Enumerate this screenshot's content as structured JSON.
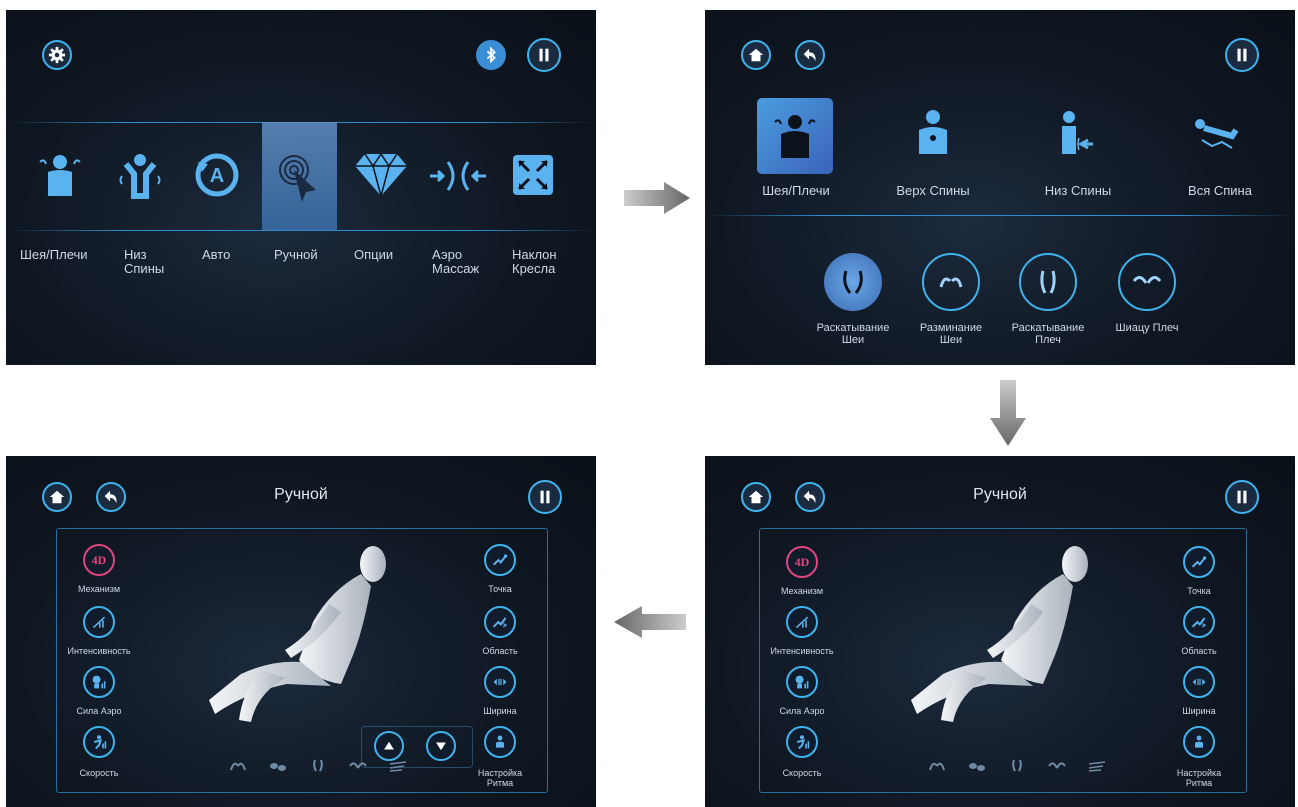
{
  "panel1": {
    "items": [
      {
        "icon": "person-shoulders-icon",
        "label": "Шея/Плечи"
      },
      {
        "icon": "lower-back-icon",
        "label": "Низ\nСпины"
      },
      {
        "icon": "auto-icon",
        "label": "Авто"
      },
      {
        "icon": "manual-touch-icon",
        "label": "Ручной"
      },
      {
        "icon": "diamond-icon",
        "label": "Опции"
      },
      {
        "icon": "air-massage-icon",
        "label": "Аэро\nМассаж"
      },
      {
        "icon": "recline-icon",
        "label": "Наклон\nКресла"
      }
    ],
    "selected_index": 3
  },
  "panel2": {
    "zones": [
      "Шея/Плечи",
      "Верх Спины",
      "Низ Спины",
      "Вся Спина"
    ],
    "techniques": [
      "Раскатывание\nШеи",
      "Разминание\nШеи",
      "Раскатывание\nПлеч",
      "Шиацу Плеч"
    ]
  },
  "panel3": {
    "title": "Ручной",
    "left": [
      {
        "icon": "4d-icon",
        "text": "4D",
        "label": "Механизм"
      },
      {
        "icon": "intensity-icon",
        "label": "Интенсивность"
      },
      {
        "icon": "air-strength-icon",
        "label": "Сила Аэро"
      },
      {
        "icon": "speed-icon",
        "label": "Скорость"
      }
    ],
    "right": [
      {
        "icon": "point-icon",
        "label": "Точка"
      },
      {
        "icon": "area-icon",
        "label": "Область"
      },
      {
        "icon": "width-icon",
        "label": "Ширина"
      },
      {
        "icon": "rhythm-icon",
        "label": "Настройка\nРитма"
      }
    ]
  },
  "panel4": {
    "title": "Ручной",
    "left": [
      {
        "icon": "4d-icon",
        "text": "4D",
        "label": "Механизм"
      },
      {
        "icon": "intensity-icon",
        "label": "Интенсивность"
      },
      {
        "icon": "air-strength-icon",
        "label": "Сила Аэро"
      },
      {
        "icon": "speed-icon",
        "label": "Скорость"
      }
    ],
    "right": [
      {
        "icon": "point-icon",
        "label": "Точка"
      },
      {
        "icon": "area-icon",
        "label": "Область"
      },
      {
        "icon": "width-icon",
        "label": "Ширина"
      },
      {
        "icon": "rhythm-icon",
        "label": "Настройка\nРитма"
      }
    ]
  },
  "colors": {
    "accent": "#3fb3ee",
    "bg": "#0c121c",
    "fourd": "#e0457f",
    "selected": "#4a7fb8"
  }
}
